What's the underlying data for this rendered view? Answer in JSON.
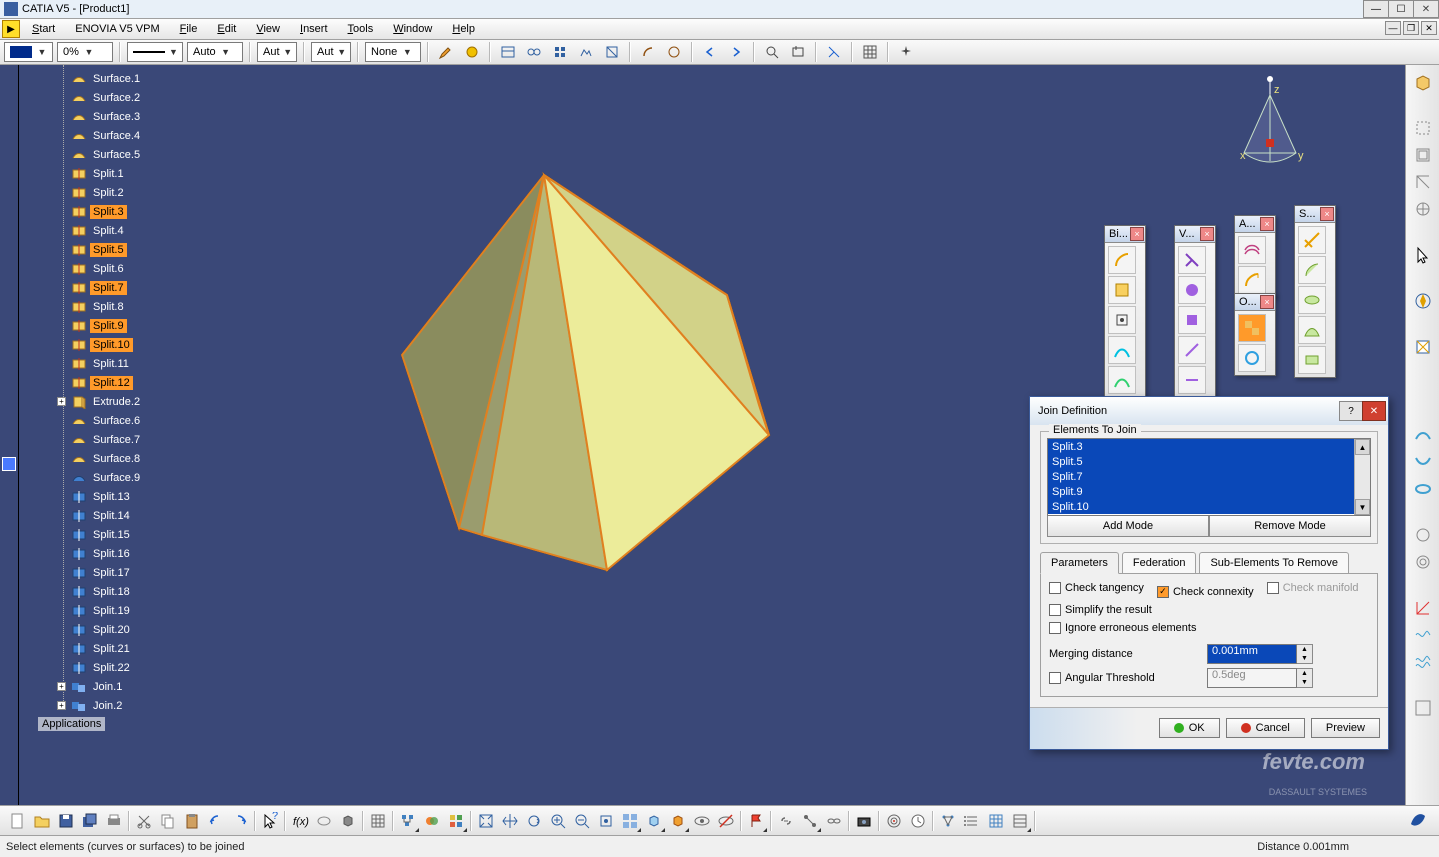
{
  "window": {
    "title": "CATIA V5 - [Product1]"
  },
  "menu": {
    "start": "Start",
    "enovia": "ENOVIA V5 VPM",
    "file": "File",
    "edit": "Edit",
    "view": "View",
    "insert": "Insert",
    "tools": "Tools",
    "window": "Window",
    "help": "Help"
  },
  "propbar": {
    "opacity": "0%",
    "linestyle": "",
    "thickness": "Auto",
    "pt": "Aut",
    "render": "Aut",
    "layer": "None"
  },
  "tree": {
    "items": [
      {
        "label": "Surface.1",
        "icon": "surface"
      },
      {
        "label": "Surface.2",
        "icon": "surface"
      },
      {
        "label": "Surface.3",
        "icon": "surface"
      },
      {
        "label": "Surface.4",
        "icon": "surface"
      },
      {
        "label": "Surface.5",
        "icon": "surface"
      },
      {
        "label": "Split.1",
        "icon": "split"
      },
      {
        "label": "Split.2",
        "icon": "split"
      },
      {
        "label": "Split.3",
        "icon": "split",
        "sel": true
      },
      {
        "label": "Split.4",
        "icon": "split"
      },
      {
        "label": "Split.5",
        "icon": "split",
        "sel": true
      },
      {
        "label": "Split.6",
        "icon": "split"
      },
      {
        "label": "Split.7",
        "icon": "split",
        "sel": true
      },
      {
        "label": "Split.8",
        "icon": "split"
      },
      {
        "label": "Split.9",
        "icon": "split",
        "sel": true
      },
      {
        "label": "Split.10",
        "icon": "split",
        "sel": true
      },
      {
        "label": "Split.11",
        "icon": "split"
      },
      {
        "label": "Split.12",
        "icon": "split",
        "sel": true
      },
      {
        "label": "Extrude.2",
        "icon": "extrude",
        "exp": "+"
      },
      {
        "label": "Surface.6",
        "icon": "surface"
      },
      {
        "label": "Surface.7",
        "icon": "surface"
      },
      {
        "label": "Surface.8",
        "icon": "surface"
      },
      {
        "label": "Surface.9",
        "icon": "surface-p"
      },
      {
        "label": "Split.13",
        "icon": "split-p"
      },
      {
        "label": "Split.14",
        "icon": "split-p"
      },
      {
        "label": "Split.15",
        "icon": "split-p"
      },
      {
        "label": "Split.16",
        "icon": "split-p"
      },
      {
        "label": "Split.17",
        "icon": "split-p"
      },
      {
        "label": "Split.18",
        "icon": "split-p"
      },
      {
        "label": "Split.19",
        "icon": "split-p"
      },
      {
        "label": "Split.20",
        "icon": "split-p"
      },
      {
        "label": "Split.21",
        "icon": "split-p"
      },
      {
        "label": "Split.22",
        "icon": "split-p"
      },
      {
        "label": "Join.1",
        "icon": "join",
        "exp": "+"
      },
      {
        "label": "Join.2",
        "icon": "join",
        "exp": "+"
      }
    ],
    "applications": "Applications"
  },
  "palettes": {
    "bi": {
      "title": "Bi..."
    },
    "v": {
      "title": "V..."
    },
    "a": {
      "title": "A..."
    },
    "o": {
      "title": "O..."
    },
    "s": {
      "title": "S..."
    }
  },
  "dialog": {
    "title": "Join Definition",
    "fieldset_legend": "Elements To Join",
    "list": [
      "Split.3",
      "Split.5",
      "Split.7",
      "Split.9",
      "Split.10"
    ],
    "add_mode": "Add Mode",
    "remove_mode": "Remove Mode",
    "tabs": {
      "parameters": "Parameters",
      "federation": "Federation",
      "subelements": "Sub-Elements To Remove"
    },
    "check_tangency": "Check tangency",
    "check_connexity": "Check connexity",
    "check_manifold": "Check manifold",
    "simplify": "Simplify the result",
    "ignore": "Ignore erroneous elements",
    "merging_distance_label": "Merging distance",
    "merging_distance": "0.001mm",
    "angular_label": "Angular Threshold",
    "angular": "0.5deg",
    "ok": "OK",
    "cancel": "Cancel",
    "preview": "Preview"
  },
  "statusbar": {
    "message": "Select elements (curves or surfaces) to be joined",
    "distance": "Distance  0.001mm"
  },
  "watermark": "fevte.com"
}
